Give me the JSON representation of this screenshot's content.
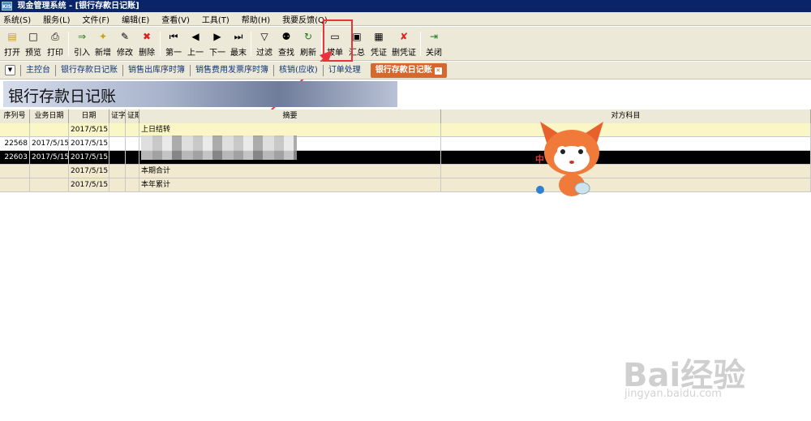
{
  "window": {
    "title": "现金管理系统 - [银行存款日记账]",
    "icon_text": "KIS"
  },
  "menu": [
    "系统(S)",
    "服务(L)",
    "文件(F)",
    "编辑(E)",
    "查看(V)",
    "工具(T)",
    "帮助(H)",
    "我要反馈(Q)"
  ],
  "toolbar": [
    {
      "label": "打开",
      "icon": "open-icon"
    },
    {
      "label": "预览",
      "icon": "preview-icon"
    },
    {
      "label": "打印",
      "icon": "print-icon"
    },
    {
      "label": "引入",
      "icon": "import-icon"
    },
    {
      "label": "新增",
      "icon": "new-icon"
    },
    {
      "label": "修改",
      "icon": "edit-icon"
    },
    {
      "label": "删除",
      "icon": "delete-icon"
    },
    {
      "label": "第一",
      "icon": "first-icon"
    },
    {
      "label": "上一",
      "icon": "prev-icon"
    },
    {
      "label": "下一",
      "icon": "next-icon"
    },
    {
      "label": "最末",
      "icon": "last-icon"
    },
    {
      "label": "过滤",
      "icon": "filter-icon"
    },
    {
      "label": "查找",
      "icon": "find-icon"
    },
    {
      "label": "刷新",
      "icon": "refresh-icon"
    },
    {
      "label": "拔单",
      "icon": "bill-icon"
    },
    {
      "label": "汇总",
      "icon": "summary-icon"
    },
    {
      "label": "凭证",
      "icon": "voucher-icon"
    },
    {
      "label": "删凭证",
      "icon": "delete-voucher-icon"
    },
    {
      "label": "关闭",
      "icon": "close-icon"
    }
  ],
  "tabs": [
    "主控台",
    "银行存款日记账",
    "销售出库序时簿",
    "销售费用发票序时簿",
    "核销(应收)",
    "订单处理"
  ],
  "active_tab": "银行存款日记账",
  "banner_title": "银行存款日记账",
  "grid": {
    "columns": [
      "序列号",
      "业务日期",
      "日期",
      "证字",
      "证期",
      "摘要",
      "对方科目"
    ],
    "rows": [
      {
        "seq": "",
        "bdate": "",
        "date": "2017/5/15",
        "summary": "上日结转",
        "style": "yellow"
      },
      {
        "seq": "22568",
        "bdate": "2017/5/15",
        "date": "2017/5/15",
        "summary": "",
        "style": "white"
      },
      {
        "seq": "22603",
        "bdate": "2017/5/15",
        "date": "2017/5/15",
        "summary": "",
        "style": "black"
      },
      {
        "seq": "",
        "bdate": "",
        "date": "2017/5/15",
        "summary": "本期合计",
        "style": "tan"
      },
      {
        "seq": "",
        "bdate": "",
        "date": "2017/5/15",
        "summary": "本年累计",
        "style": "tan"
      }
    ]
  },
  "overlay": {
    "mascot_text": "中"
  },
  "watermark": {
    "brand": "Bai经验",
    "url": "jingyan.baidu.com"
  },
  "colors": {
    "titlebar": "#0a246a",
    "highlight": "#e8323c",
    "active_tab": "#d6672d"
  }
}
